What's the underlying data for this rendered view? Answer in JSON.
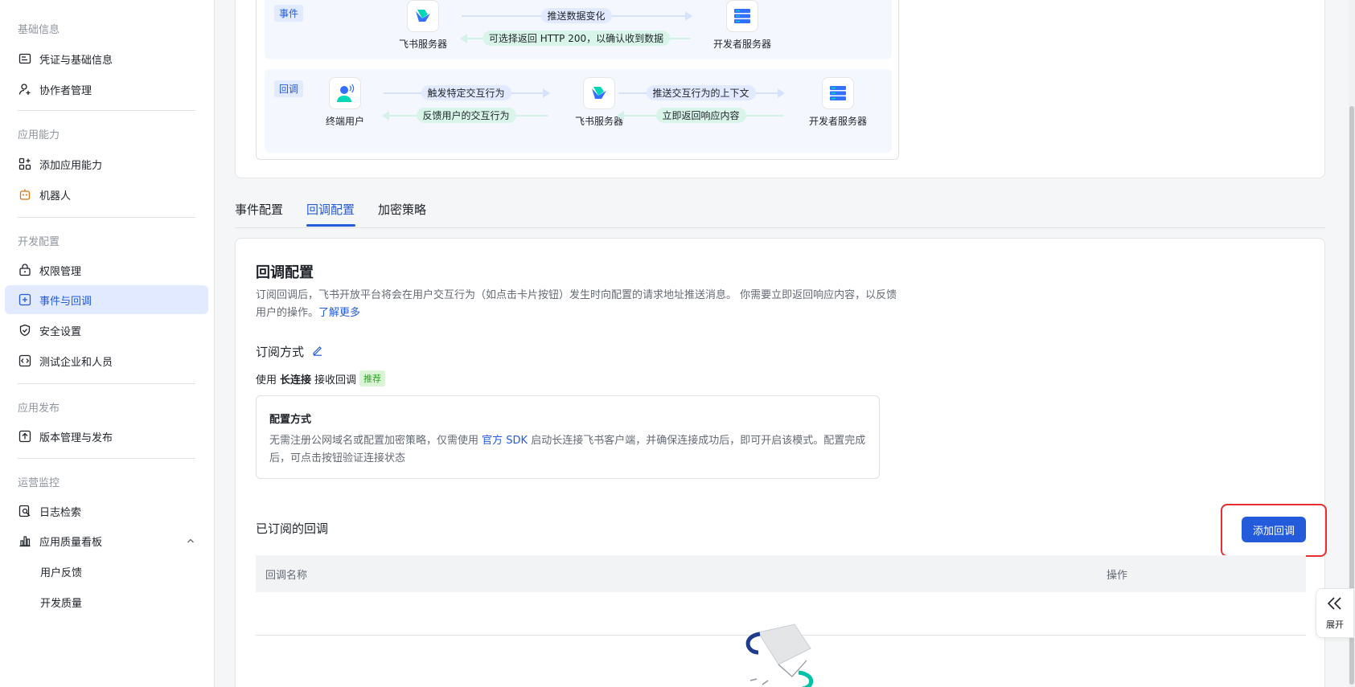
{
  "sidebar": {
    "groups": [
      "基础信息",
      "应用能力",
      "开发配置",
      "应用发布",
      "运营监控"
    ],
    "items": [
      {
        "label": "凭证与基础信息"
      },
      {
        "label": "协作者管理"
      },
      {
        "label": "添加应用能力"
      },
      {
        "label": "机器人"
      },
      {
        "label": "权限管理"
      },
      {
        "label": "事件与回调"
      },
      {
        "label": "安全设置"
      },
      {
        "label": "测试企业和人员"
      },
      {
        "label": "版本管理与发布"
      },
      {
        "label": "日志检索"
      },
      {
        "label": "应用质量看板"
      },
      {
        "label": "用户反馈"
      },
      {
        "label": "开发质量"
      }
    ]
  },
  "diagram": {
    "event": {
      "tag": "事件",
      "from": "飞书服务器",
      "to": "开发者服务器",
      "push": "推送数据变化",
      "reply": "可选择返回 HTTP 200，以确认收到数据"
    },
    "callback": {
      "tag": "回调",
      "user": "终端用户",
      "server": "飞书服务器",
      "dev": "开发者服务器",
      "trigger": "触发特定交互行为",
      "feedback": "反馈用户的交互行为",
      "push_ctx": "推送交互行为的上下文",
      "respond": "立即返回响应内容"
    }
  },
  "tabs": [
    "事件配置",
    "回调配置",
    "加密策略"
  ],
  "main": {
    "title": "回调配置",
    "desc": "订阅回调后，飞书开放平台将会在用户交互行为（如点击卡片按钮）发生时向配置的请求地址推送消息。 你需要立即返回响应内容，以反馈用户的操作。",
    "learn_more": "了解更多",
    "subscribe_mode": "订阅方式",
    "use_prefix": "使用",
    "use_bold": "长连接",
    "use_suffix": "接收回调",
    "badge": "推荐",
    "config_title": "配置方式",
    "config_pre": "无需注册公网域名或配置加密策略，仅需使用",
    "config_link": "官方 SDK",
    "config_post": "启动长连接飞书客户端，并确保连接成功后，即可开启该模式。配置完成后，可点击按钮验证连接状态",
    "subscribed_title": "已订阅的回调",
    "add_button": "添加回调",
    "col_name": "回调名称",
    "col_action": "操作"
  },
  "float": {
    "label": "展开"
  },
  "colors": {
    "accent": "#245bdb",
    "highlight": "#e5302f"
  }
}
